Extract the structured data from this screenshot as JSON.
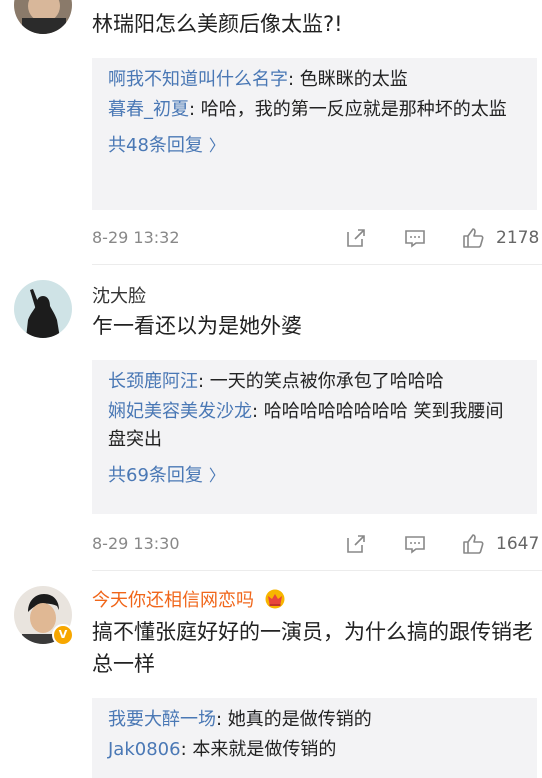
{
  "comments": [
    {
      "text": "林瑞阳怎么美颜后像太监?!",
      "replies": [
        {
          "name": "啊我不知道叫什么名字",
          "text": ": 色眯眯的太监"
        },
        {
          "name": "暮春_初夏",
          "text": ": 哈哈，我的第一反应就是那种坏的太监"
        }
      ],
      "more": "共48条回复",
      "time": "8-29 13:32",
      "likes": "2178"
    },
    {
      "username": "沈大脸",
      "text": "乍一看还以为是她外婆",
      "replies": [
        {
          "name": "长颈鹿阿汪",
          "text": ": 一天的笑点被你承包了哈哈哈"
        },
        {
          "name": "娴妃美容美发沙龙",
          "text": ": 哈哈哈哈哈哈哈哈 笑到我腰间盘突出"
        }
      ],
      "more": "共69条回复",
      "time": "8-29 13:30",
      "likes": "1647"
    },
    {
      "username": "今天你还相信网恋吗",
      "text": "搞不懂张庭好好的一演员，为什么搞的跟传销老总一样",
      "replies": [
        {
          "name": "我要大醉一场",
          "text": ": 她真的是做传销的"
        },
        {
          "name": "Jak0806",
          "text": ": 本来就是做传销的"
        }
      ]
    }
  ],
  "icons": [
    "share-icon",
    "comment-icon",
    "like-icon",
    "chevron-right-icon",
    "crown-badge-icon",
    "verified-icon"
  ],
  "colors": {
    "link": "#4a78b5",
    "vip_name": "#f0661a",
    "reply_bg": "#f3f3f5",
    "meta": "#888888"
  }
}
